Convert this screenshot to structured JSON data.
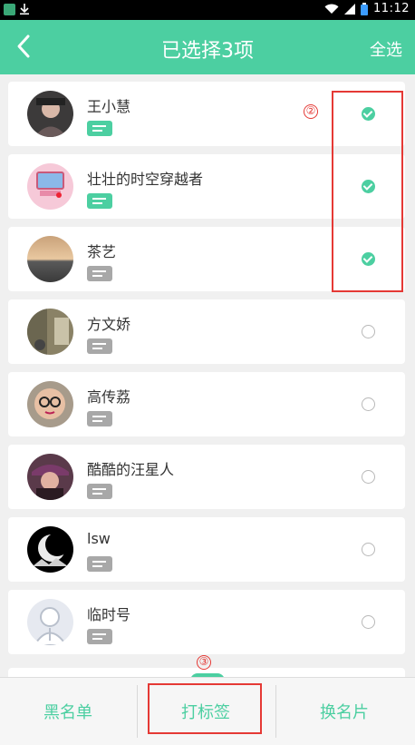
{
  "status_bar": {
    "time": "11:12"
  },
  "header": {
    "title": "已选择3项",
    "select_all": "全选"
  },
  "contacts": [
    {
      "name": "王小慧",
      "selected": true
    },
    {
      "name": "壮壮的时空穿越者",
      "selected": true
    },
    {
      "name": "茶艺",
      "selected": true
    },
    {
      "name": "方文娇",
      "selected": false
    },
    {
      "name": "高传荔",
      "selected": false
    },
    {
      "name": "酷酷的汪星人",
      "selected": false
    },
    {
      "name": "lsw",
      "selected": false
    },
    {
      "name": "临时号",
      "selected": false
    }
  ],
  "annotations": {
    "marker_2": "②",
    "marker_3": "③"
  },
  "bottom": {
    "blacklist": "黑名单",
    "tag": "打标签",
    "swap_card": "换名片"
  },
  "colors": {
    "accent": "#4ccfa1",
    "annotation": "#e53935"
  }
}
